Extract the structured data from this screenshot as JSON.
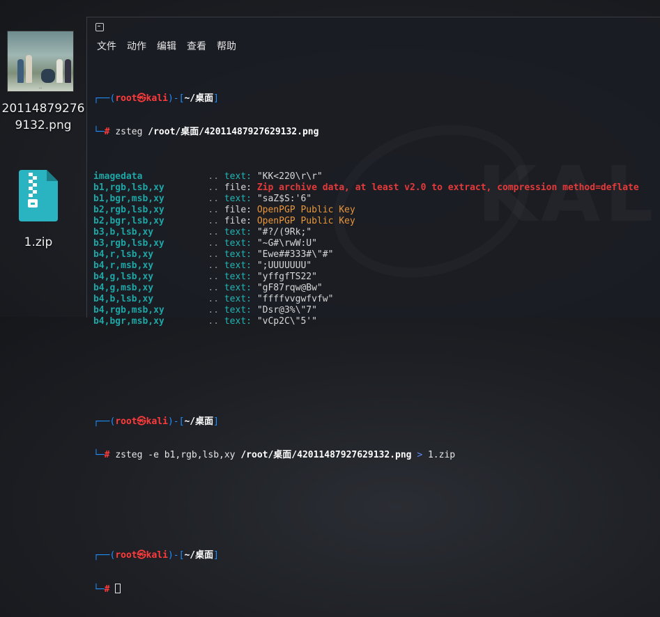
{
  "desktop": {
    "png_icon_label_line1": "20114879276",
    "png_icon_label_line2": "9132.png",
    "zip_icon_label": "1.zip",
    "thumb_caption": "..."
  },
  "terminal": {
    "menu": [
      "文件",
      "动作",
      "编辑",
      "查看",
      "帮助"
    ],
    "prompt": {
      "corner_top": "┌──(",
      "user": "root",
      "at": "㉿",
      "host": "kali",
      "close": ")-[",
      "cwd": "~/桌面",
      "cwd_close": "]",
      "corner_bottom": "└─",
      "hash": "#"
    },
    "cmd1": {
      "program": "zsteg",
      "arg": "/root/桌面/42011487927629132.png"
    },
    "results": [
      {
        "name": "imagedata",
        "sep": "..",
        "kind": "text:",
        "value": "\"KK<220\\r\\r\"",
        "style": "txt"
      },
      {
        "name": "b1,rgb,lsb,xy",
        "sep": "..",
        "kind": "file:",
        "value": "Zip archive data, at least v2.0 to extract, compression method=deflate",
        "style": "err"
      },
      {
        "name": "b1,bgr,msb,xy",
        "sep": "..",
        "kind": "text:",
        "value": "\"saZ$S:'6\"",
        "style": "txt"
      },
      {
        "name": "b2,rgb,lsb,xy",
        "sep": "..",
        "kind": "file:",
        "value": "OpenPGP Public Key",
        "style": "org"
      },
      {
        "name": "b2,bgr,lsb,xy",
        "sep": "..",
        "kind": "file:",
        "value": "OpenPGP Public Key",
        "style": "org"
      },
      {
        "name": "b3,b,lsb,xy",
        "sep": "..",
        "kind": "text:",
        "value": "\"#?/(9Rk;\"",
        "style": "txt"
      },
      {
        "name": "b3,rgb,lsb,xy",
        "sep": "..",
        "kind": "text:",
        "value": "\"~G#\\rwW:U\"",
        "style": "txt"
      },
      {
        "name": "b4,r,lsb,xy",
        "sep": "..",
        "kind": "text:",
        "value": "\"Ewe##333#\\\"#\"",
        "style": "txt"
      },
      {
        "name": "b4,r,msb,xy",
        "sep": "..",
        "kind": "text:",
        "value": "\";UUUUUUU\"",
        "style": "txt"
      },
      {
        "name": "b4,g,lsb,xy",
        "sep": "..",
        "kind": "text:",
        "value": "\"yffgfTS22\"",
        "style": "txt"
      },
      {
        "name": "b4,g,msb,xy",
        "sep": "..",
        "kind": "text:",
        "value": "\"gF87rqw@Bw\"",
        "style": "txt"
      },
      {
        "name": "b4,b,lsb,xy",
        "sep": "..",
        "kind": "text:",
        "value": "\"ffffvvgwfvfw\"",
        "style": "txt"
      },
      {
        "name": "b4,rgb,msb,xy",
        "sep": "..",
        "kind": "text:",
        "value": "\"Dsr@3%\\\"7\"",
        "style": "txt"
      },
      {
        "name": "b4,bgr,msb,xy",
        "sep": "..",
        "kind": "text:",
        "value": "\"vCp2C\\\"5'\"",
        "style": "txt"
      }
    ],
    "cmd2": {
      "program": "zsteg",
      "flag": "-e",
      "flag_arg": "b1,rgb,lsb,xy",
      "arg": "/root/桌面/42011487927629132.png",
      "redirect": ">",
      "outfile": "1.zip"
    }
  },
  "colors": {
    "prompt_blue": "#1e90ff",
    "prompt_red": "#ff3b3b",
    "cyan": "#24b5b5",
    "error_red": "#e53a3a",
    "orange": "#e8963a"
  },
  "icons": [
    "terminal-icon",
    "zip-file-icon",
    "image-thumbnail"
  ]
}
